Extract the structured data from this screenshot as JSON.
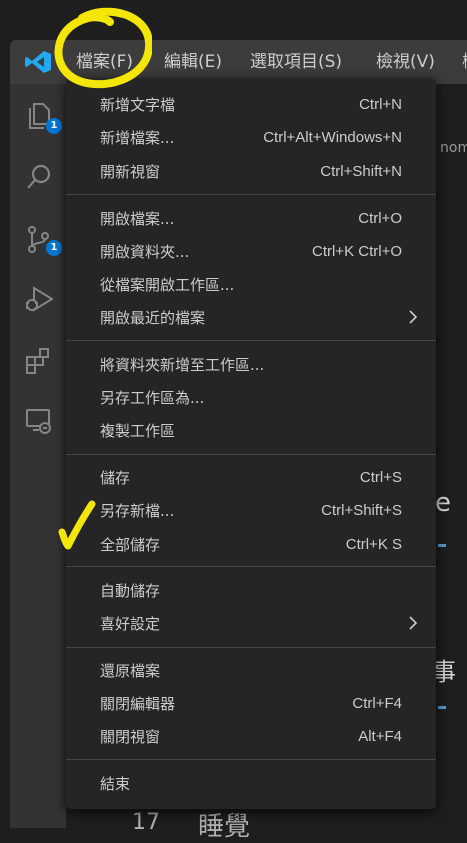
{
  "menubar": {
    "items": [
      {
        "label": "檔案(F)"
      },
      {
        "label": "編輯(E)"
      },
      {
        "label": "選取項目(S)"
      },
      {
        "label": "檢視(V)"
      }
    ]
  },
  "activity_bar": {
    "explorer_badge": "1",
    "scm_badge": "1"
  },
  "editor_peek": {
    "breadcrumb_fragment": "nome",
    "char_e": "e",
    "char_hai": "事",
    "line_number": "17",
    "line_text": "睡覺"
  },
  "file_menu": {
    "groups": [
      [
        {
          "label": "新增文字檔",
          "shortcut": "Ctrl+N"
        },
        {
          "label": "新增檔案...",
          "shortcut": "Ctrl+Alt+Windows+N"
        },
        {
          "label": "開新視窗",
          "shortcut": "Ctrl+Shift+N"
        }
      ],
      [
        {
          "label": "開啟檔案...",
          "shortcut": "Ctrl+O"
        },
        {
          "label": "開啟資料夾...",
          "shortcut": "Ctrl+K Ctrl+O"
        },
        {
          "label": "從檔案開啟工作區...",
          "shortcut": ""
        },
        {
          "label": "開啟最近的檔案",
          "shortcut": ""
        }
      ],
      [
        {
          "label": "將資料夾新增至工作區...",
          "shortcut": ""
        },
        {
          "label": "另存工作區為...",
          "shortcut": ""
        },
        {
          "label": "複製工作區",
          "shortcut": ""
        }
      ],
      [
        {
          "label": "儲存",
          "shortcut": "Ctrl+S"
        },
        {
          "label": "另存新檔...",
          "shortcut": "Ctrl+Shift+S"
        },
        {
          "label": "全部儲存",
          "shortcut": "Ctrl+K S"
        }
      ],
      [
        {
          "label": "自動儲存",
          "shortcut": ""
        },
        {
          "label": "喜好設定",
          "shortcut": ""
        }
      ],
      [
        {
          "label": "還原檔案",
          "shortcut": ""
        },
        {
          "label": "關閉編輯器",
          "shortcut": "Ctrl+F4"
        },
        {
          "label": "關閉視窗",
          "shortcut": "Alt+F4"
        }
      ],
      [
        {
          "label": "結束",
          "shortcut": ""
        }
      ]
    ]
  },
  "colors": {
    "accent": "#0078d4",
    "annotation": "#f5e60a",
    "menu_bg": "#252526",
    "menubar_bg": "#3c3c3c"
  }
}
